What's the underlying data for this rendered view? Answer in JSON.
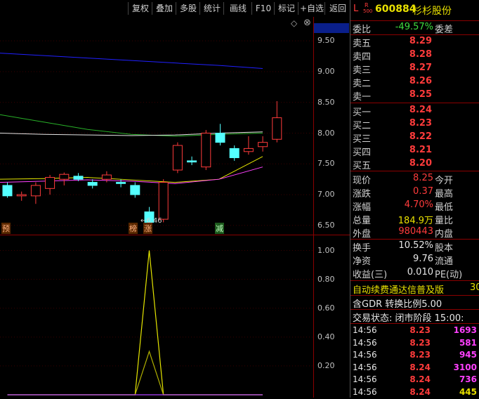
{
  "toolbar": {
    "buttons": [
      "复权",
      "叠加",
      "多股",
      "统计",
      "画线",
      "F10",
      "标记",
      "+自选",
      "返回"
    ]
  },
  "header": {
    "badge": "L",
    "market_top": "R",
    "market_bottom": "500",
    "code": "600884",
    "name": "杉杉股份",
    "diamond": "◇",
    "close_icon": "⊗"
  },
  "axis": {
    "main_ticks": [
      "9.89",
      "9.50",
      "9.00",
      "8.50",
      "8.00",
      "7.50",
      "7.00",
      "6.50"
    ],
    "sub_ticks": [
      "1.00",
      "0.80",
      "0.60",
      "0.40",
      "0.20"
    ]
  },
  "chart_labels": {
    "low_price": "←6.46",
    "marker_yu": "预",
    "marker_bang": "榜",
    "marker_zhang": "涨",
    "marker_jian": "减"
  },
  "chart_data": {
    "type": "candlestick",
    "ylim": [
      6.35,
      9.89
    ],
    "candles": [
      {
        "o": 7.15,
        "h": 7.2,
        "l": 6.95,
        "c": 6.98
      },
      {
        "o": 6.98,
        "h": 7.05,
        "l": 6.9,
        "c": 7.0
      },
      {
        "o": 6.98,
        "h": 7.2,
        "l": 6.85,
        "c": 7.15
      },
      {
        "o": 7.1,
        "h": 7.32,
        "l": 7.0,
        "c": 7.28
      },
      {
        "o": 7.25,
        "h": 7.36,
        "l": 7.15,
        "c": 7.33
      },
      {
        "o": 7.3,
        "h": 7.35,
        "l": 7.22,
        "c": 7.25
      },
      {
        "o": 7.2,
        "h": 7.25,
        "l": 7.1,
        "c": 7.15
      },
      {
        "o": 7.25,
        "h": 7.38,
        "l": 7.2,
        "c": 7.32
      },
      {
        "o": 7.2,
        "h": 7.25,
        "l": 7.12,
        "c": 7.18
      },
      {
        "o": 7.15,
        "h": 7.2,
        "l": 6.95,
        "c": 7.0
      },
      {
        "o": 6.72,
        "h": 6.8,
        "l": 6.46,
        "c": 6.55
      },
      {
        "o": 6.6,
        "h": 7.25,
        "l": 6.55,
        "c": 7.2
      },
      {
        "o": 7.4,
        "h": 7.85,
        "l": 7.35,
        "c": 7.8
      },
      {
        "o": 7.55,
        "h": 7.62,
        "l": 7.48,
        "c": 7.53
      },
      {
        "o": 7.45,
        "h": 8.05,
        "l": 7.4,
        "c": 8.0
      },
      {
        "o": 8.0,
        "h": 8.15,
        "l": 7.8,
        "c": 7.85
      },
      {
        "o": 7.75,
        "h": 7.8,
        "l": 7.55,
        "c": 7.6
      },
      {
        "o": 7.7,
        "h": 7.95,
        "l": 7.65,
        "c": 7.75
      },
      {
        "o": 7.78,
        "h": 7.95,
        "l": 7.7,
        "c": 7.85
      },
      {
        "o": 7.9,
        "h": 8.52,
        "l": 7.85,
        "c": 8.25
      }
    ],
    "up_color": "#ff3b3b",
    "down_color": "#54ffff",
    "ma_series": [
      {
        "color": "#2020ff",
        "values": [
          9.3,
          9.26,
          9.22,
          9.18,
          9.14,
          9.1,
          9.05
        ]
      },
      {
        "color": "#28b028",
        "values": [
          8.3,
          8.18,
          8.06,
          7.98,
          7.95,
          7.98,
          8.0
        ]
      },
      {
        "color": "#e6e6e6",
        "values": [
          8.0,
          7.98,
          7.97,
          7.96,
          7.97,
          8.0,
          8.02
        ]
      },
      {
        "color": "#e6e600",
        "values": [
          7.25,
          7.26,
          7.28,
          7.24,
          7.2,
          7.25,
          7.62
        ]
      },
      {
        "color": "#ff40ff",
        "values": [
          7.2,
          7.22,
          7.24,
          7.22,
          7.18,
          7.25,
          7.45
        ]
      }
    ],
    "sub_ylim": [
      0,
      1.1
    ],
    "sub_series": [
      {
        "color": "#e6e600",
        "points": [
          [
            0,
            0
          ],
          [
            9,
            0
          ],
          [
            10,
            1.0
          ],
          [
            11,
            0
          ],
          [
            20,
            0
          ]
        ]
      },
      {
        "color": "#b0b000",
        "points": [
          [
            0,
            0
          ],
          [
            9,
            0
          ],
          [
            10,
            0.3
          ],
          [
            11,
            0
          ],
          [
            20,
            0
          ]
        ]
      },
      {
        "color": "#b040ff",
        "points": [
          [
            0,
            0
          ],
          [
            20,
            0
          ]
        ]
      }
    ]
  },
  "panel": {
    "weibi": {
      "label": "委比",
      "value": "-49.57%",
      "suffix": "委差"
    },
    "sell": [
      {
        "label": "卖五",
        "price": "8.29"
      },
      {
        "label": "卖四",
        "price": "8.28"
      },
      {
        "label": "卖三",
        "price": "8.27"
      },
      {
        "label": "卖二",
        "price": "8.26"
      },
      {
        "label": "卖一",
        "price": "8.25"
      }
    ],
    "buy": [
      {
        "label": "买一",
        "price": "8.24"
      },
      {
        "label": "买二",
        "price": "8.23"
      },
      {
        "label": "买三",
        "price": "8.22"
      },
      {
        "label": "买四",
        "price": "8.21"
      },
      {
        "label": "买五",
        "price": "8.20"
      }
    ],
    "quote": [
      {
        "label": "现价",
        "value": "8.25",
        "right": "今开",
        "color": "red"
      },
      {
        "label": "涨跌",
        "value": "0.37",
        "right": "最高",
        "color": "red"
      },
      {
        "label": "涨幅",
        "value": "4.70%",
        "right": "最低",
        "color": "red"
      },
      {
        "label": "总量",
        "value": "184.9万",
        "right": "量比",
        "color": "yellow"
      },
      {
        "label": "外盘",
        "value": "980443",
        "right": "内盘",
        "color": "red"
      }
    ],
    "fund": [
      {
        "label": "换手",
        "value": "10.52%",
        "right": "股本"
      },
      {
        "label": "净资",
        "value": "9.76",
        "right": "流通"
      },
      {
        "label": "收益(三)",
        "value": "0.010",
        "right": "PE(动)"
      }
    ],
    "promo": "自动续费通达信普及版",
    "promo_tail": "30",
    "gdr": "含GDR 转换比例5.00",
    "status": "交易状态: 闭市阶段 15:00:",
    "ticks": [
      {
        "time": "14:56",
        "price": "8.23",
        "vol": "1693",
        "vcolor": "mag"
      },
      {
        "time": "14:56",
        "price": "8.23",
        "vol": "581",
        "vcolor": "mag"
      },
      {
        "time": "14:56",
        "price": "8.23",
        "vol": "945",
        "vcolor": "mag"
      },
      {
        "time": "14:56",
        "price": "8.24",
        "vol": "3100",
        "vcolor": "mag"
      },
      {
        "time": "14:56",
        "price": "8.24",
        "vol": "736",
        "vcolor": "mag"
      },
      {
        "time": "14:56",
        "price": "8.24",
        "vol": "445",
        "vcolor": "yellow"
      }
    ]
  }
}
